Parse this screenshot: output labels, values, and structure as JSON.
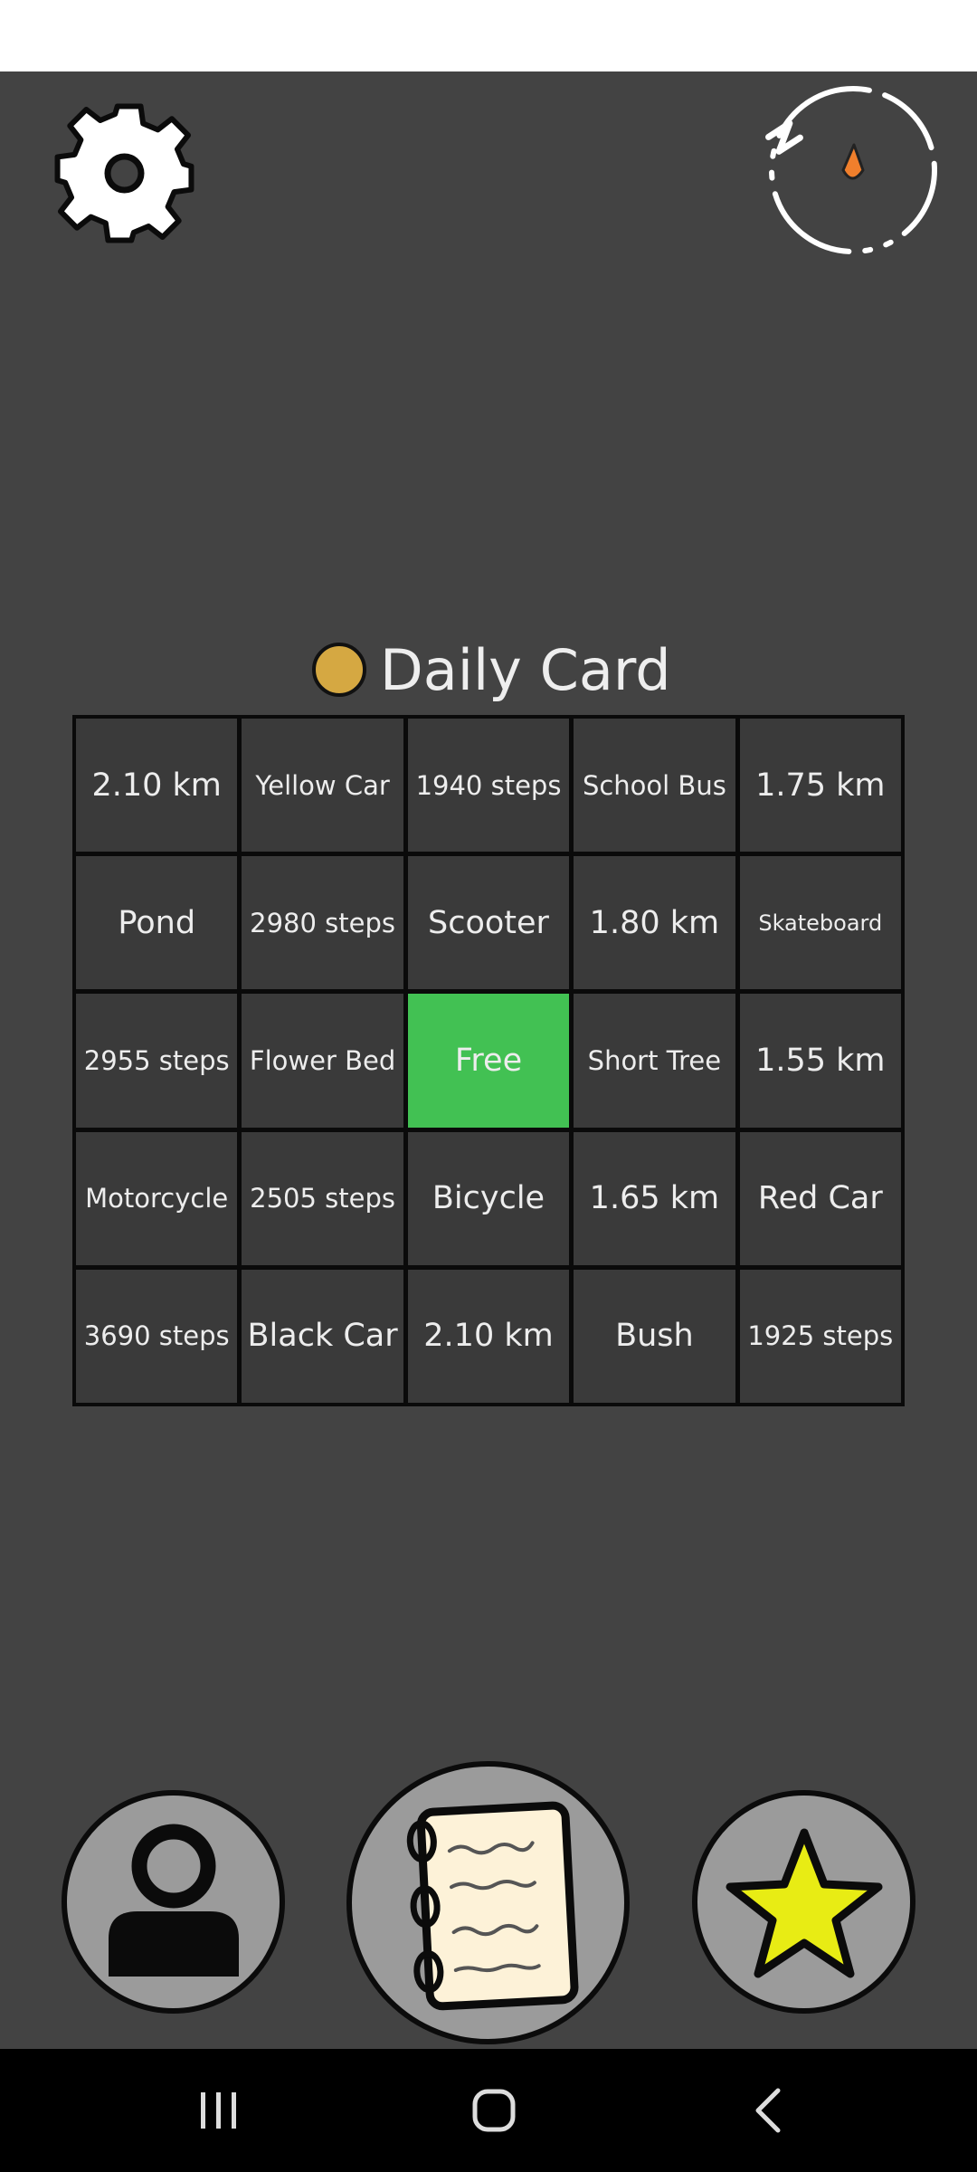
{
  "title": "Daily Card",
  "icons": {
    "settings": "gear-icon",
    "compass": "compass-icon",
    "coin": "coin-icon",
    "profile": "person-icon",
    "notebook": "notebook-icon",
    "favorites": "star-icon"
  },
  "colors": {
    "background": "#434343",
    "cell": "#3a3a3a",
    "free_cell": "#42c153",
    "coin": "#d5a842",
    "compass_needle": "#f07f2c",
    "star": "#e8ec14"
  },
  "grid": [
    [
      "2.10 km",
      "Yellow Car",
      "1940 steps",
      "School Bus",
      "1.75 km"
    ],
    [
      "Pond",
      "2980 steps",
      "Scooter",
      "1.80 km",
      "Skateboard"
    ],
    [
      "2955 steps",
      "Flower Bed",
      "Free",
      "Short Tree",
      "1.55 km"
    ],
    [
      "Motorcycle",
      "2505 steps",
      "Bicycle",
      "1.65 km",
      "Red Car"
    ],
    [
      "3690 steps",
      "Black Car",
      "2.10 km",
      "Bush",
      "1925 steps"
    ]
  ]
}
